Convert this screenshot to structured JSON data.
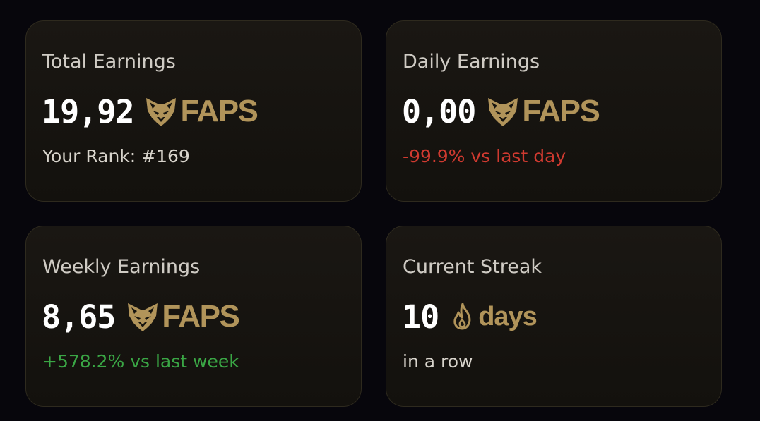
{
  "colors": {
    "background": "#07060c",
    "card_background": "#16140f",
    "card_border": "#2e2a1e",
    "accent_gold": "#b1945a",
    "value_white": "#ffffff",
    "negative": "#d03a30",
    "positive": "#3aa645"
  },
  "cards": {
    "total": {
      "title": "Total Earnings",
      "amount": "19,92",
      "unit": "FAPS",
      "icon": "fox-icon",
      "subtext": "Your Rank: #169"
    },
    "daily": {
      "title": "Daily Earnings",
      "amount": "0,00",
      "unit": "FAPS",
      "icon": "fox-icon",
      "subtext": "-99.9% vs last day"
    },
    "weekly": {
      "title": "Weekly Earnings",
      "amount": "8,65",
      "unit": "FAPS",
      "icon": "fox-icon",
      "subtext": "+578.2% vs last week"
    },
    "streak": {
      "title": "Current Streak",
      "amount": "10",
      "unit": "days",
      "icon": "flame-icon",
      "subtext": "in a row"
    }
  }
}
